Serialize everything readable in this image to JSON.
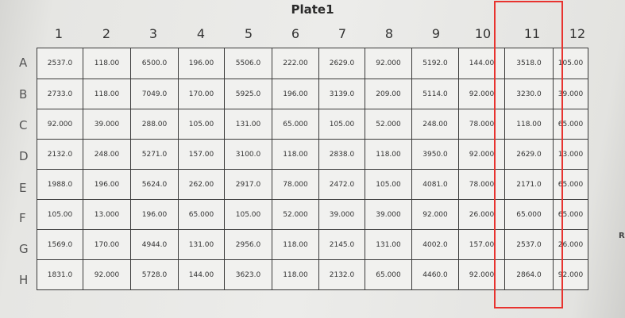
{
  "plate": {
    "title": "Plate1",
    "columns": [
      "1",
      "2",
      "3",
      "4",
      "5",
      "6",
      "7",
      "8",
      "9",
      "10",
      "11",
      "12"
    ],
    "rows": [
      "A",
      "B",
      "C",
      "D",
      "E",
      "F",
      "G",
      "H"
    ],
    "values": [
      [
        "2537.0",
        "118.00",
        "6500.0",
        "196.00",
        "5506.0",
        "222.00",
        "2629.0",
        "92.000",
        "5192.0",
        "144.00",
        "3518.0",
        "105.00"
      ],
      [
        "2733.0",
        "118.00",
        "7049.0",
        "170.00",
        "5925.0",
        "196.00",
        "3139.0",
        "209.00",
        "5114.0",
        "92.000",
        "3230.0",
        "39.000"
      ],
      [
        "92.000",
        "39.000",
        "288.00",
        "105.00",
        "131.00",
        "65.000",
        "105.00",
        "52.000",
        "248.00",
        "78.000",
        "118.00",
        "65.000"
      ],
      [
        "2132.0",
        "248.00",
        "5271.0",
        "157.00",
        "3100.0",
        "118.00",
        "2838.0",
        "118.00",
        "3950.0",
        "92.000",
        "2629.0",
        "13.000"
      ],
      [
        "1988.0",
        "196.00",
        "5624.0",
        "262.00",
        "2917.0",
        "78.000",
        "2472.0",
        "105.00",
        "4081.0",
        "78.000",
        "2171.0",
        "65.000"
      ],
      [
        "105.00",
        "13.000",
        "196.00",
        "65.000",
        "105.00",
        "52.000",
        "39.000",
        "39.000",
        "92.000",
        "26.000",
        "65.000",
        "65.000"
      ],
      [
        "1569.0",
        "170.00",
        "4944.0",
        "131.00",
        "2956.0",
        "118.00",
        "2145.0",
        "131.00",
        "4002.0",
        "157.00",
        "2537.0",
        "26.000"
      ],
      [
        "1831.0",
        "92.000",
        "5728.0",
        "144.00",
        "3623.0",
        "118.00",
        "2132.0",
        "65.000",
        "4460.0",
        "92.000",
        "2864.0",
        "92.000"
      ]
    ]
  },
  "annotation": {
    "highlighted_column": "11",
    "color": "#e8332f"
  },
  "edge_text": "R"
}
